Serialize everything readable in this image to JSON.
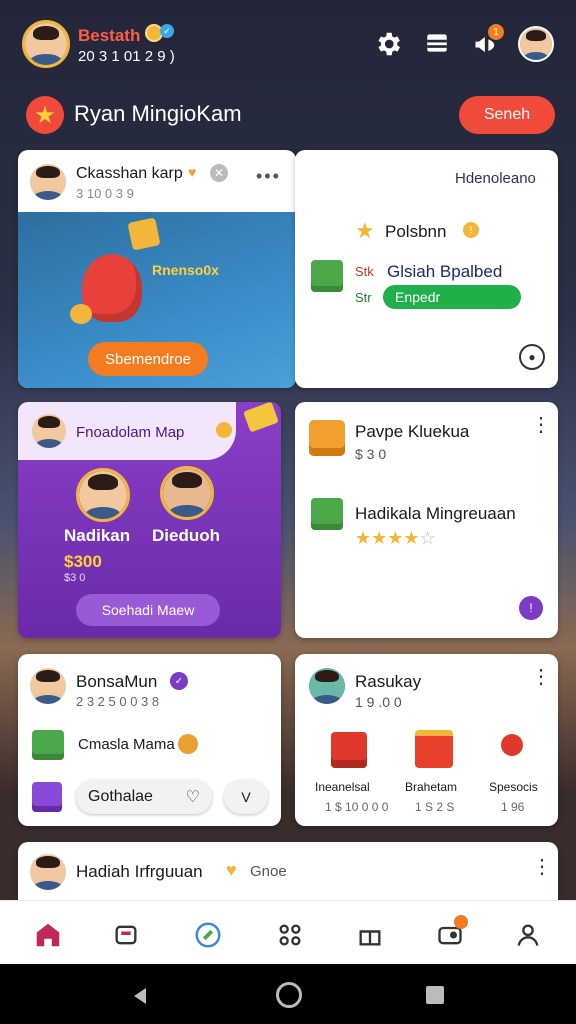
{
  "header": {
    "user_name": "Bestath",
    "user_sub": "20 3 1 01 2 9 )",
    "balance_badge": "",
    "notif_count": "1"
  },
  "title_bar": {
    "title": "Ryan MingioKam",
    "action_label": "Seneh"
  },
  "card1": {
    "title": "Ckasshan karp",
    "subtitle": "3 10 0 3 9",
    "promo_label": "Rnenso0x",
    "button_label": "Sbemendroe"
  },
  "card2": {
    "header_label": "Hdenoleano",
    "item1_label": "Polsbnn",
    "item2_label": "Glsiah Bpalbed",
    "item2_prefix": "Stk",
    "progress_prefix": "Str",
    "progress_label": "Enpedr"
  },
  "card3": {
    "banner_label": "Fnoadolam Map",
    "person1": "Nadikan",
    "person2": "Dieduoh",
    "amount": "$300",
    "amount_sub": "$3 0",
    "button_label": "Soehadi Maew"
  },
  "card4": {
    "title": "Pavpe Kluekua",
    "subtitle": "$ 3 0",
    "item_label": "Hadikala Mingreuaan",
    "rating": 4
  },
  "card5": {
    "title": "BonsaMun",
    "subtitle": "2 3 2 5 0 0 3 8",
    "item_label": "Cmasla Mama",
    "pill_label": "Gothalae",
    "pill2_label": "V"
  },
  "card6": {
    "title": "Rasukay",
    "subtitle": "1 9 .0 0",
    "gifts": [
      {
        "name": "Ineanelsal",
        "value": "1 $ 10 0 0 0"
      },
      {
        "name": "Brahetam",
        "value": "1 S 2 S"
      },
      {
        "name": "Spesocis",
        "value": "1 96"
      }
    ]
  },
  "card7": {
    "title": "Hadiah Irfrguuan",
    "suffix": "Gnoe"
  },
  "colors": {
    "accent": "#f04a3a",
    "purple": "#7b3bc4",
    "green": "#1fb04a",
    "orange": "#f47b20"
  }
}
